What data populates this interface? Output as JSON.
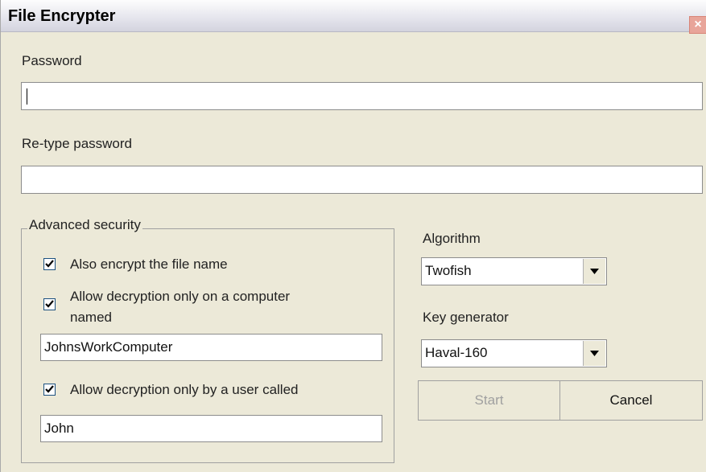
{
  "window": {
    "title": "File Encrypter",
    "close_glyph": "×"
  },
  "password": {
    "label": "Password",
    "value": ""
  },
  "retype_password": {
    "label": "Re-type password",
    "value": ""
  },
  "advanced_security": {
    "title": "Advanced security",
    "encrypt_filename": {
      "label": "Also encrypt the file name",
      "checked": true
    },
    "computer_restriction": {
      "label_line1": "Allow decryption only on a computer",
      "label_line2": "named",
      "checked": true,
      "value": "JohnsWorkComputer"
    },
    "user_restriction": {
      "label": "Allow decryption only by a user called",
      "checked": true,
      "value": "John"
    }
  },
  "algorithm": {
    "label": "Algorithm",
    "selected": "Twofish"
  },
  "key_generator": {
    "label": "Key generator",
    "selected": "Haval-160"
  },
  "buttons": {
    "start": "Start",
    "cancel": "Cancel"
  },
  "colors": {
    "disabled_text": "#a0a0a0",
    "close_button": "#e8a59a"
  }
}
